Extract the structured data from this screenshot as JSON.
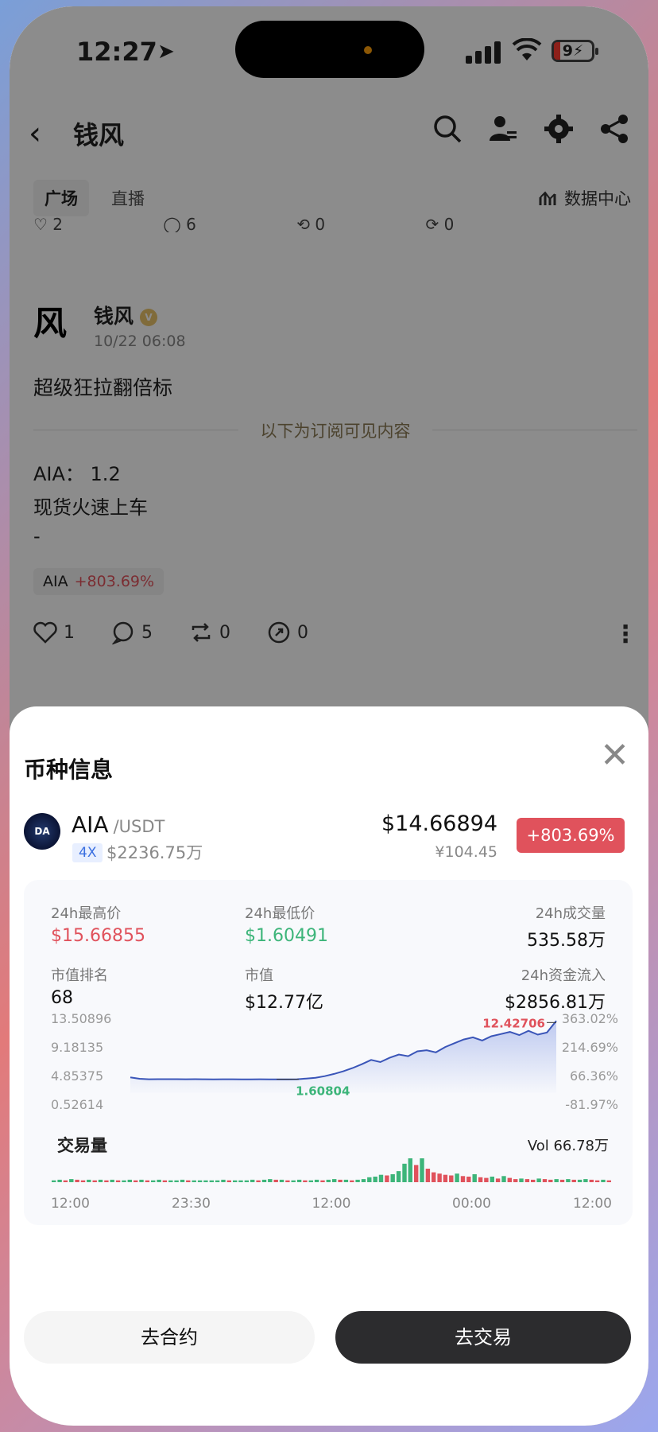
{
  "status_bar": {
    "time": "12:27",
    "battery": "9"
  },
  "nav": {
    "back": "‹",
    "title": "钱风"
  },
  "tabs": [
    {
      "label": "广场"
    },
    {
      "label": "直播"
    }
  ],
  "data_center": "数据中心",
  "prev_post_actions": {
    "likes": "2",
    "comments": "6",
    "reposts": "0",
    "shares": "0"
  },
  "post": {
    "avatar_char": "风",
    "author": "钱风",
    "time": "10/22 06:08",
    "text": "超级狂拉翻倍标",
    "divider_label": "以下为订阅可见内容",
    "lines": [
      "AIA：  1.2",
      "现货火速上车",
      "-"
    ],
    "coin_tag": {
      "symbol": "AIA",
      "change": "+803.69%"
    },
    "actions": {
      "likes": "1",
      "comments": "5",
      "reposts": "0",
      "shares": "0"
    }
  },
  "sheet": {
    "title": "币种信息",
    "close": "✕",
    "coin": {
      "logo_text": "DA",
      "symbol": "AIA",
      "pair": "/USDT",
      "leverage": "4X",
      "mcap_small": "$2236.75万",
      "price": "$14.66894",
      "price_cny": "¥104.45",
      "change": "+803.69%"
    },
    "stats": {
      "high_label": "24h最高价",
      "high": "$15.66855",
      "low_label": "24h最低价",
      "low": "$1.60491",
      "volume_label": "24h成交量",
      "volume": "535.58万",
      "rank_label": "市值排名",
      "rank": "68",
      "mcap_label": "市值",
      "mcap": "$12.77亿",
      "inflow_label": "24h资金流入",
      "inflow": "$2856.81万"
    },
    "volume_section": {
      "title": "交易量",
      "value": "Vol 66.78万"
    },
    "buttons": {
      "contract": "去合约",
      "trade": "去交易"
    }
  },
  "chart_data": [
    {
      "type": "line",
      "y_ticks_left": [
        "13.50896",
        "9.18135",
        "4.85375",
        "0.52614"
      ],
      "y_ticks_right": [
        "363.02%",
        "214.69%",
        "66.36%",
        "-81.97%"
      ],
      "ylim": [
        0.52614,
        13.50896
      ],
      "annotations": {
        "max": "12.42706",
        "min": "1.60804"
      },
      "values": [
        1.95,
        1.7,
        1.62,
        1.63,
        1.64,
        1.63,
        1.62,
        1.63,
        1.62,
        1.61,
        1.62,
        1.62,
        1.61,
        1.61,
        1.62,
        1.61,
        1.61,
        1.608,
        1.62,
        1.75,
        1.9,
        2.2,
        2.6,
        3.1,
        3.7,
        4.4,
        5.2,
        4.8,
        5.6,
        6.2,
        5.9,
        6.8,
        7.0,
        6.6,
        7.6,
        8.3,
        9.0,
        9.4,
        8.8,
        9.6,
        10.0,
        10.4,
        9.8,
        10.6,
        9.9,
        10.3,
        12.43
      ],
      "grid": false
    },
    {
      "type": "bar",
      "title": "交易量",
      "x_ticks": [
        "12:00",
        "23:30",
        "12:00",
        "00:00",
        "12:00"
      ],
      "values": [
        3,
        4,
        3,
        5,
        4,
        3,
        4,
        3,
        4,
        3,
        4,
        3,
        3,
        4,
        3,
        4,
        3,
        3,
        4,
        3,
        3,
        3,
        4,
        3,
        3,
        3,
        3,
        3,
        3,
        4,
        3,
        3,
        3,
        3,
        4,
        3,
        4,
        5,
        4,
        4,
        3,
        3,
        4,
        3,
        3,
        4,
        3,
        4,
        5,
        4,
        4,
        3,
        4,
        5,
        8,
        9,
        12,
        11,
        13,
        18,
        30,
        40,
        28,
        44,
        22,
        16,
        14,
        12,
        11,
        14,
        10,
        9,
        13,
        8,
        7,
        9,
        6,
        10,
        7,
        5,
        6,
        5,
        4,
        6,
        5,
        4,
        5,
        4,
        5,
        4,
        4,
        5,
        4,
        3,
        4,
        3
      ],
      "colors": {
        "up": "#3db57a",
        "down": "#e0525c"
      }
    }
  ]
}
